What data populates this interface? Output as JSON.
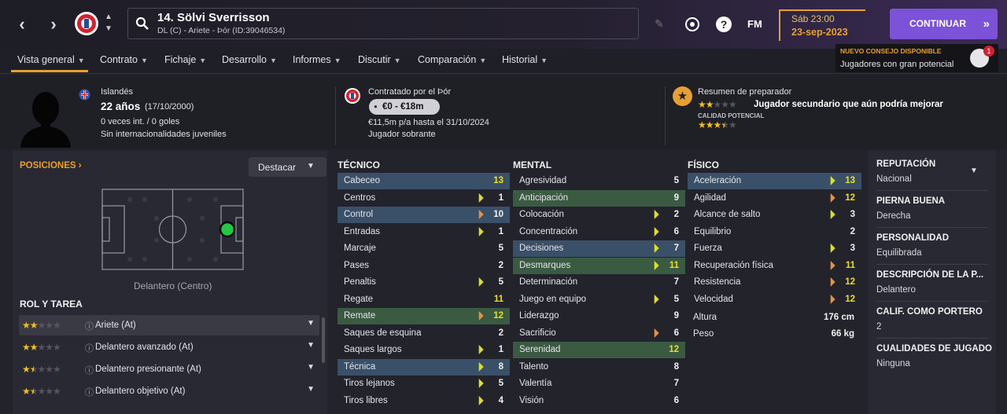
{
  "header": {
    "player_title": "14. Sölvi Sverrisson",
    "player_subtitle": "DL (C) - Ariete - Þór (ID:39046534)",
    "date_day": "Sáb 23:00",
    "date_full": "23-sep-2023",
    "continue_label": "CONTINUAR",
    "fm_label": "FM"
  },
  "menu": [
    "Vista general",
    "Contrato",
    "Fichaje",
    "Desarrollo",
    "Informes",
    "Discutir",
    "Comparación",
    "Historial"
  ],
  "tip": {
    "title": "NUEVO CONSEJO DISPONIBLE",
    "text": "Jugadores con gran potencial",
    "count": "1"
  },
  "info": {
    "nationality": "Islandés",
    "age": "22 años",
    "dob": "(17/10/2000)",
    "caps": "0 veces int. / 0 goles",
    "youth_caps": "Sin internacionalidades juveniles",
    "contracted": "Contratado por el Þór",
    "value": "€0 - €18m",
    "wage": "€11,5m p/a hasta el 31/10/2024",
    "status": "Jugador sobrante",
    "coach_title": "Resumen de preparador",
    "coach_text": "Jugador secundario que aún podría mejorar",
    "potential_label": "CALIDAD POTENCIAL",
    "current_stars": 2,
    "potential_stars": 3.5
  },
  "positions": {
    "title": "POSICIONES",
    "dropdown": "Destacar",
    "position_label": "Delantero (Centro)",
    "roles_title": "ROL Y TAREA",
    "roles": [
      {
        "label": "Ariete (At)",
        "stars": 2
      },
      {
        "label": "Delantero avanzado (At)",
        "stars": 2
      },
      {
        "label": "Delantero presionante (At)",
        "stars": 1.5
      },
      {
        "label": "Delantero objetivo (At)",
        "stars": 1.5
      }
    ]
  },
  "attributes": {
    "tecnico_title": "TÉCNICO",
    "tecnico": [
      {
        "name": "Cabeceo",
        "value": "13",
        "hl": "b",
        "arrow": ""
      },
      {
        "name": "Centros",
        "value": "1",
        "hl": "",
        "arrow": "lime"
      },
      {
        "name": "Control",
        "value": "10",
        "hl": "b",
        "arrow": "org"
      },
      {
        "name": "Entradas",
        "value": "1",
        "hl": "",
        "arrow": "lime"
      },
      {
        "name": "Marcaje",
        "value": "5",
        "hl": "",
        "arrow": ""
      },
      {
        "name": "Pases",
        "value": "2",
        "hl": "",
        "arrow": ""
      },
      {
        "name": "Penaltis",
        "value": "5",
        "hl": "",
        "arrow": "lime"
      },
      {
        "name": "Regate",
        "value": "11",
        "hl": "",
        "arrow": ""
      },
      {
        "name": "Remate",
        "value": "12",
        "hl": "g",
        "arrow": "org"
      },
      {
        "name": "Saques de esquina",
        "value": "2",
        "hl": "",
        "arrow": ""
      },
      {
        "name": "Saques largos",
        "value": "1",
        "hl": "",
        "arrow": "lime"
      },
      {
        "name": "Técnica",
        "value": "8",
        "hl": "b",
        "arrow": "lime"
      },
      {
        "name": "Tiros lejanos",
        "value": "5",
        "hl": "",
        "arrow": "lime"
      },
      {
        "name": "Tiros libres",
        "value": "4",
        "hl": "",
        "arrow": "lime"
      }
    ],
    "mental_title": "MENTAL",
    "mental": [
      {
        "name": "Agresividad",
        "value": "5",
        "hl": "",
        "arrow": ""
      },
      {
        "name": "Anticipación",
        "value": "9",
        "hl": "g",
        "arrow": ""
      },
      {
        "name": "Colocación",
        "value": "2",
        "hl": "",
        "arrow": "lime"
      },
      {
        "name": "Concentración",
        "value": "6",
        "hl": "",
        "arrow": "lime"
      },
      {
        "name": "Decisiones",
        "value": "7",
        "hl": "b",
        "arrow": "lime"
      },
      {
        "name": "Desmarques",
        "value": "11",
        "hl": "g",
        "arrow": "lime"
      },
      {
        "name": "Determinación",
        "value": "7",
        "hl": "",
        "arrow": ""
      },
      {
        "name": "Juego en equipo",
        "value": "5",
        "hl": "",
        "arrow": "lime"
      },
      {
        "name": "Liderazgo",
        "value": "9",
        "hl": "",
        "arrow": ""
      },
      {
        "name": "Sacrificio",
        "value": "6",
        "hl": "",
        "arrow": "org"
      },
      {
        "name": "Serenidad",
        "value": "12",
        "hl": "g",
        "arrow": ""
      },
      {
        "name": "Talento",
        "value": "8",
        "hl": "",
        "arrow": ""
      },
      {
        "name": "Valentía",
        "value": "7",
        "hl": "",
        "arrow": ""
      },
      {
        "name": "Visión",
        "value": "6",
        "hl": "",
        "arrow": ""
      }
    ],
    "fisico_title": "FÍSICO",
    "fisico": [
      {
        "name": "Aceleración",
        "value": "13",
        "hl": "b",
        "arrow": "lime"
      },
      {
        "name": "Agilidad",
        "value": "12",
        "hl": "",
        "arrow": "org"
      },
      {
        "name": "Alcance de salto",
        "value": "3",
        "hl": "",
        "arrow": "lime"
      },
      {
        "name": "Equilibrio",
        "value": "2",
        "hl": "",
        "arrow": ""
      },
      {
        "name": "Fuerza",
        "value": "3",
        "hl": "",
        "arrow": "lime"
      },
      {
        "name": "Recuperación física",
        "value": "11",
        "hl": "",
        "arrow": "org"
      },
      {
        "name": "Resistencia",
        "value": "12",
        "hl": "",
        "arrow": "org"
      },
      {
        "name": "Velocidad",
        "value": "12",
        "hl": "",
        "arrow": "org"
      }
    ],
    "height_label": "Altura",
    "height": "176 cm",
    "weight_label": "Peso",
    "weight": "66 kg"
  },
  "right_panel": [
    {
      "label": "REPUTACIÓN",
      "value": "Nacional"
    },
    {
      "label": "PIERNA BUENA",
      "value": "Derecha"
    },
    {
      "label": "PERSONALIDAD",
      "value": "Equilibrada"
    },
    {
      "label": "DESCRIPCIÓN DE LA P...",
      "value": "Delantero"
    },
    {
      "label": "CALIF. COMO PORTERO",
      "value": "2"
    },
    {
      "label": "CUALIDADES DE JUGADO",
      "value": "Ninguna"
    }
  ],
  "colors": {
    "accent": "#7b52d8",
    "highlight_blue": "#3a5068",
    "highlight_green": "#3b5a42",
    "star": "#f0c020"
  }
}
